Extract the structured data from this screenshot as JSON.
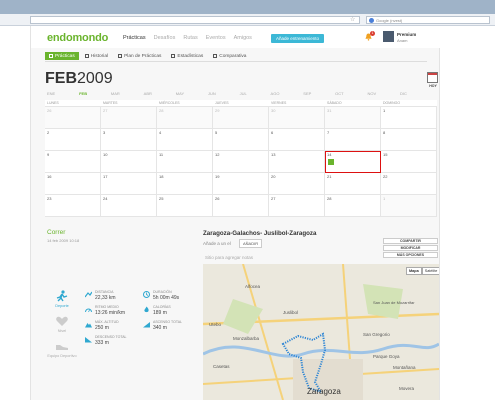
{
  "browser": {
    "search_placeholder": "Google (nvest)"
  },
  "header": {
    "logo": "endomondo",
    "nav": [
      "Prácticas",
      "Desafíos",
      "Rutas",
      "Eventos",
      "Amigos"
    ],
    "add_workout": "Añade entrenamiento",
    "notification_count": "1",
    "user_name": "Premium",
    "user_sub": "Anam"
  },
  "tabs": [
    "Prácticas",
    "Historial",
    "Plan de Prácticas",
    "Estadísticas",
    "Comparativa"
  ],
  "calendar": {
    "month": "FEB",
    "year": "2009",
    "today_label": "HOY",
    "months": [
      "ENE",
      "FEB",
      "MAR",
      "ABR",
      "MAY",
      "JUN",
      "JUL",
      "AGO",
      "SEP",
      "OCT",
      "NOV",
      "DIC"
    ],
    "weekdays": [
      "LUNES",
      "MARTES",
      "MIÉRCOLES",
      "JUEVES",
      "VIERNES",
      "SÁBADO",
      "DOMINGO"
    ],
    "weeks": [
      [
        "26",
        "27",
        "28",
        "29",
        "30",
        "31",
        "1"
      ],
      [
        "2",
        "3",
        "4",
        "5",
        "6",
        "7",
        "8"
      ],
      [
        "9",
        "10",
        "11",
        "12",
        "13",
        "14",
        "15"
      ],
      [
        "16",
        "17",
        "18",
        "19",
        "20",
        "21",
        "22"
      ],
      [
        "23",
        "24",
        "25",
        "26",
        "27",
        "28",
        "1"
      ]
    ]
  },
  "activity": {
    "sport": "Correr",
    "date": "14 feb 2009 10:18",
    "sport_items": [
      "Deporte",
      "Nivel",
      "Equipo Deportivo"
    ],
    "stats": [
      {
        "label": "DISTANCIA",
        "value": "22,33 km",
        "icon": "distance-icon"
      },
      {
        "label": "DURACIÓN",
        "value": "5h 00m 49s",
        "icon": "duration-icon"
      },
      {
        "label": "RITMO MEDIO",
        "value": "13:26 min/km",
        "icon": "pace-icon"
      },
      {
        "label": "CALORÍAS",
        "value": "189 m",
        "icon": "calories-icon"
      },
      {
        "label": "MÁX. ALTITUD",
        "value": "250 m",
        "icon": "altitude-icon"
      },
      {
        "label": "ASCENSO TOTAL",
        "value": "340 m",
        "icon": "ascent-icon"
      },
      {
        "label": "DESCENSO TOTAL",
        "value": "333 m",
        "icon": "descent-icon"
      }
    ]
  },
  "route": {
    "title": "Zaragoza-Galachos- Juslibol-Zaragoza",
    "add_to_label": "Añade a un el",
    "add_to_button": "AÑADIR",
    "tags_placeholder": "Sitio para agregar notas",
    "buttons": [
      "COMPARTIR",
      "MODIFICAR",
      "MÁS OPCIONES"
    ],
    "map_types": [
      "Mapa",
      "Satélite"
    ],
    "places": [
      "Alfocea",
      "Juslibol",
      "Utebo",
      "Monzalbarba",
      "Casetas",
      "San Juan de Mozarrifar",
      "San Gregorio",
      "Parque Goya",
      "Zaragoza",
      "Montañana",
      "Movera"
    ]
  }
}
